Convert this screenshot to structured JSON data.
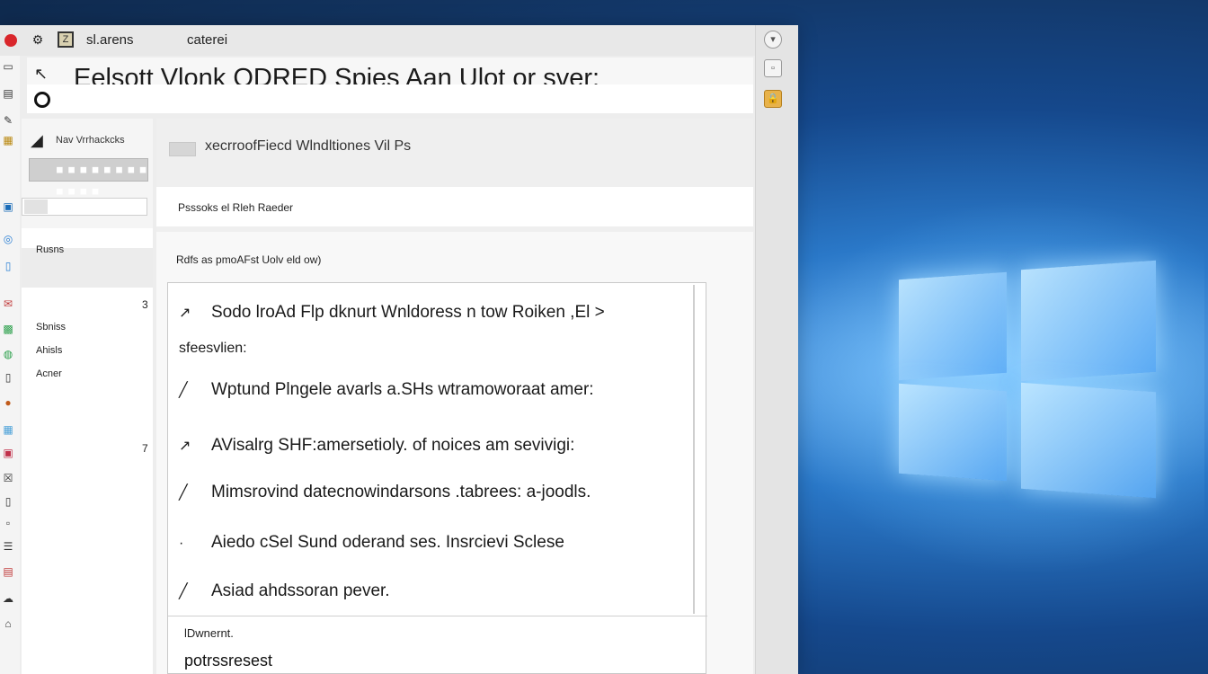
{
  "titlebar": {
    "title1": "sl.arens",
    "title2": "caterei"
  },
  "address": {
    "text": "Eelsott Vlonk ODRED Spjes Aan Ulot or sver:"
  },
  "sidebar": {
    "brand": "Nav Vrrhackcks",
    "status": "■ ■ ■ ■ ■ ■ ■ ■ ■ ■ ■ ■",
    "items": [
      {
        "label": "Rusns"
      },
      {
        "label": "Sbniss"
      },
      {
        "label": "Ahisls"
      },
      {
        "label": "Acner"
      }
    ],
    "nums": [
      "3",
      "7"
    ]
  },
  "main": {
    "title": "xecrroofFiecd Wlndltiones Vil Ps",
    "bar_text": "Psssoks el Rleh Raeder",
    "subheading": "Rdfs as pmoAFst Uolv eld ow)"
  },
  "card": {
    "rows": [
      {
        "mark": "↗",
        "text": "Sodo lroAd Flp dknurt Wnldoress n tow Roiken ,El >"
      },
      {
        "mark": "",
        "text": "sfeesvlien:"
      },
      {
        "mark": "╱",
        "text": "Wptund Plngele avarls a.SHs wtramoworaat amer:"
      },
      {
        "mark": "↗",
        "text": "AVisalrg SHF:amersetioly. of noices am sevivigi:"
      },
      {
        "mark": "╱",
        "text": "Mimsrovind datecnowindarsons .tabrees: a-joodls."
      },
      {
        "mark": "·",
        "text": "Aiedo cSel Sund oderand ses. Insrcievi Sclese"
      },
      {
        "mark": "╱",
        "text": "Asiad ahdssoran pever."
      }
    ],
    "footer_label": "lDwnernt.",
    "footer_value": "potrssresest"
  },
  "colors": {
    "accent": "#d9262b",
    "desktop": "#15488c"
  }
}
